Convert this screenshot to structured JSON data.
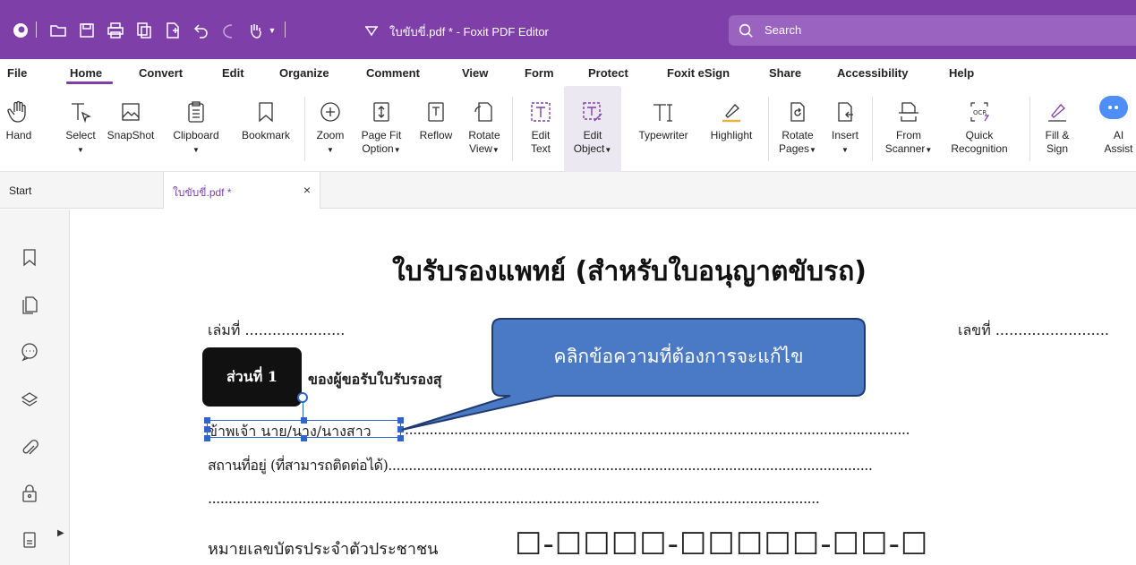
{
  "window": {
    "title": "ใบขับขี่.pdf * - Foxit PDF Editor"
  },
  "search": {
    "placeholder": "Search"
  },
  "menu": [
    "File",
    "Home",
    "Convert",
    "Edit",
    "Organize",
    "Comment",
    "View",
    "Form",
    "Protect",
    "Foxit eSign",
    "Share",
    "Accessibility",
    "Help"
  ],
  "active_menu": "Home",
  "ribbon": {
    "hand": "Hand",
    "select": "Select",
    "snapshot": "SnapShot",
    "clipboard": "Clipboard",
    "bookmark": "Bookmark",
    "zoom": "Zoom",
    "pagefit_1": "Page Fit",
    "pagefit_2": "Option",
    "reflow": "Reflow",
    "rotate_1": "Rotate",
    "rotate_2": "View",
    "edittext_1": "Edit",
    "edittext_2": "Text",
    "editobj_1": "Edit",
    "editobj_2": "Object",
    "typewriter": "Typewriter",
    "highlight": "Highlight",
    "rotatepages_1": "Rotate",
    "rotatepages_2": "Pages",
    "insert": "Insert",
    "scanner_1": "From",
    "scanner_2": "Scanner",
    "ocr_1": "Quick",
    "ocr_2": "Recognition",
    "fillsign_1": "Fill &",
    "fillsign_2": "Sign",
    "ai_1": "AI",
    "ai_2": "Assist"
  },
  "tabs": {
    "start": "Start",
    "doc": "ใบขับขี่.pdf *",
    "close": "×"
  },
  "document": {
    "title": "ใบรับรองแพทย์ (สำหรับใบอนุญาตขับรถ)",
    "book_no": "เล่มที่ ......................",
    "number": "เลขที่ .........................",
    "part_label": "ส่วนที่ 1",
    "part_heading": "ของผู้ขอรับใบรับรองสุ",
    "line1": "ข้าพเจ้า นาย/นาง/นางสาว",
    "line1_dots": "...........................................................................................................................",
    "line2": "สถานที่อยู่ (ที่สามารถติดต่อได้)......................................................................................................................",
    "line3": ".....................................................................................................................................................",
    "id_label": "หมายเลขบัตรประจำตัวประชาชน",
    "id_boxes": "☐-☐☐☐☐-☐☐☐☐☐-☐☐-☐"
  },
  "callout": {
    "text": "คลิกข้อความที่ต้องการจะแก้ไข",
    "fill": "#4a7ac6",
    "border": "#1f3b6e"
  },
  "colors": {
    "brand": "#7e3fa8",
    "selection": "#2d65c8"
  }
}
